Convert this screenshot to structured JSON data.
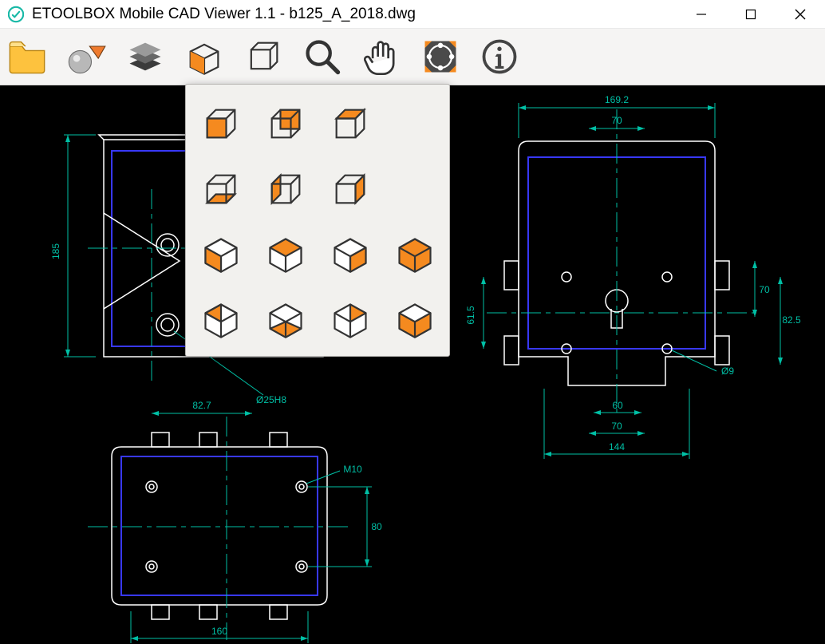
{
  "window": {
    "title": "ETOOLBOX Mobile CAD Viewer 1.1 - b125_A_2018.dwg"
  },
  "toolbar": {
    "items": [
      {
        "name": "open-file-button",
        "icon": "folder"
      },
      {
        "name": "render-mode-button",
        "icon": "sphere"
      },
      {
        "name": "layers-button",
        "icon": "layers"
      },
      {
        "name": "3d-view-button",
        "icon": "cube-solid"
      },
      {
        "name": "iso-views-button",
        "icon": "cube-wire"
      },
      {
        "name": "zoom-button",
        "icon": "magnifier"
      },
      {
        "name": "pan-button",
        "icon": "hand"
      },
      {
        "name": "orbit-button",
        "icon": "orbit"
      },
      {
        "name": "info-button",
        "icon": "info"
      }
    ]
  },
  "view_popup": {
    "items": [
      {
        "type": "cube",
        "face": "front"
      },
      {
        "type": "cube",
        "face": "back"
      },
      {
        "type": "cube",
        "face": "top"
      },
      {
        "type": "cube",
        "face": "bottom"
      },
      {
        "type": "cube",
        "face": "left"
      },
      {
        "type": "cube",
        "face": "right"
      },
      {
        "type": "hex",
        "face": "nw"
      },
      {
        "type": "hex",
        "face": "n"
      },
      {
        "type": "hex",
        "face": "ne"
      },
      {
        "type": "hex",
        "face": "iso"
      },
      {
        "type": "hex",
        "face": "sw"
      },
      {
        "type": "hex",
        "face": "s"
      },
      {
        "type": "hex",
        "face": "se"
      },
      {
        "type": "hex",
        "face": "e"
      }
    ]
  },
  "drawing": {
    "views": {
      "top_left": {
        "dimensions": {
          "d0": "185",
          "d1": "Ø25H8"
        }
      },
      "top_right": {
        "dimensions": {
          "d0": "169.2",
          "d1": "70",
          "d2": "70",
          "d3": "82.5",
          "d4": "61.5",
          "d5": "Ø9",
          "d6": "60",
          "d7": "70",
          "d8": "144"
        }
      },
      "bottom_left": {
        "dimensions": {
          "d0": "82.7",
          "d1": "M10",
          "d2": "80",
          "d3": "160"
        }
      }
    }
  }
}
